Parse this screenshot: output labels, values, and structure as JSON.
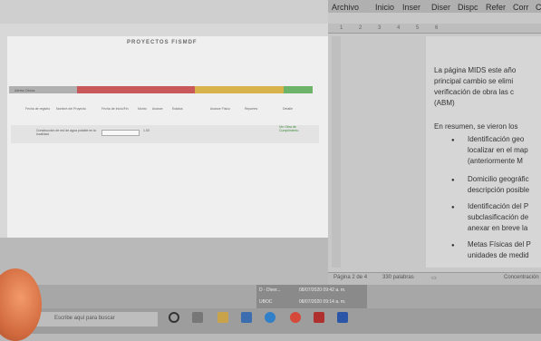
{
  "browser": {
    "page_title": "PROYECTOS FISMDF",
    "status_label": "Alerta Obras",
    "table_headers": [
      "Fecha de registro",
      "Nombre del Proyecto",
      "Fecha de Inicio/Fin",
      "Monto",
      "Avance",
      "Estatus",
      "Avance Físico",
      "Reportes",
      "Detalle"
    ],
    "row_text": "Construcción de red de agua potable en la localidad",
    "row_amount": "1.00",
    "row_link": "Ver Obra de Cumplimiento"
  },
  "word": {
    "menu": [
      "Archivo",
      "Inicio",
      "Inser",
      "Diser",
      "Dispc",
      "Refer",
      "Corr",
      "C"
    ],
    "ruler_marks": "1 2 3 4 5 6",
    "lines": [
      "La página MIDS este año",
      "principal cambio se elimi",
      "verificación de obra las c",
      "(ABM)",
      "En resumen, se vieron los"
    ],
    "bullets": [
      [
        "Identificación geo",
        "localizar en el map",
        "(anteriormente M"
      ],
      [
        "Domicilio geográfic",
        "descripción posible"
      ],
      [
        "Identificación del P",
        "subclasificación de",
        "anexar en breve la"
      ],
      [
        "Metas Físicas del P",
        "unidades de medid"
      ]
    ],
    "status_page": "Página 2 de 4",
    "status_words": "330 palabras",
    "status_focus": "Concentración"
  },
  "taskbar": {
    "search_placeholder": "Escribe aquí para buscar",
    "popup_line1": "D - Diver...",
    "popup_time1": "08/07/2020 09:42 a. m.",
    "popup_line2": "UBOC",
    "popup_time2": "08/07/2020 09:14 a. m."
  },
  "colors": {
    "red": "#c9585b",
    "yellow": "#d8b24b",
    "green": "#6db46a"
  }
}
